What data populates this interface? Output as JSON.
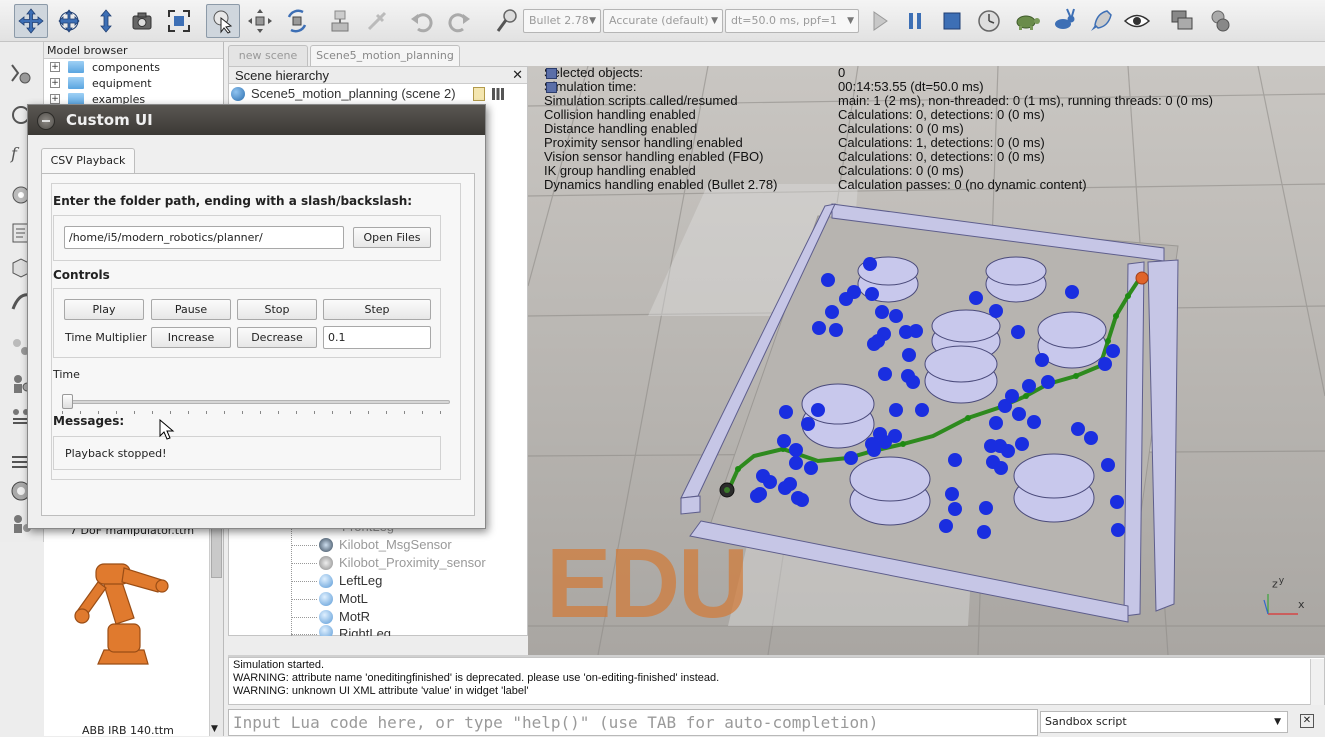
{
  "toolbar": {
    "engine": "Bullet 2.78",
    "accuracy": "Accurate (default)",
    "timestep": "dt=50.0 ms, ppf=1"
  },
  "model_browser": {
    "title": "Model browser",
    "folders": [
      "components",
      "equipment",
      "examples"
    ],
    "thumbnails": [
      {
        "label": "7 DoF manipulator.ttm"
      },
      {
        "label": "ABB IRB 140.ttm"
      }
    ]
  },
  "scene_tabs": [
    "new scene",
    "Scene5_motion_planning"
  ],
  "scene_hierarchy": {
    "title": "Scene hierarchy",
    "root": "Scene5_motion_planning (scene 2)",
    "items": [
      "Kilobot_MsgSensor",
      "Kilobot_Proximity_sensor",
      "LeftLeg",
      "MotL",
      "MotR",
      "RightLeg"
    ],
    "partial_item": "FrontLeg"
  },
  "info": {
    "rows": [
      {
        "label": "Selected objects:",
        "value": "0"
      },
      {
        "label": "Simulation time:",
        "value": "00:14:53.55 (dt=50.0 ms)"
      },
      {
        "label": "Simulation scripts called/resumed",
        "value": "main: 1 (2 ms), non-threaded: 0 (1 ms), running threads: 0 (0 ms)"
      },
      {
        "label": "Collision handling enabled",
        "value": "Calculations: 0, detections: 0 (0 ms)"
      },
      {
        "label": "Distance handling enabled",
        "value": "Calculations: 0 (0 ms)"
      },
      {
        "label": "Proximity sensor handling enabled",
        "value": "Calculations: 1, detections: 0 (0 ms)"
      },
      {
        "label": "Vision sensor handling enabled (FBO)",
        "value": "Calculations: 0, detections: 0 (0 ms)"
      },
      {
        "label": "IK group handling enabled",
        "value": "Calculations: 0 (0 ms)"
      },
      {
        "label": "Dynamics handling enabled (Bullet 2.78)",
        "value": "Calculation passes: 0 (no dynamic content)"
      }
    ]
  },
  "watermark": "EDU",
  "console": {
    "lines": [
      "Simulation started.",
      "WARNING: attribute name 'oneditingfinished' is deprecated. please use 'on-editing-finished' instead.",
      "WARNING: unknown UI XML attribute 'value' in widget 'label'"
    ],
    "input_placeholder": "Input Lua code here, or type \"help()\" (use TAB for auto-completion)",
    "script_selector": "Sandbox script"
  },
  "custom_ui": {
    "title": "Custom UI",
    "tab": "CSV Playback",
    "folder_label": "Enter the folder path, ending with a slash/backslash:",
    "folder_path": "/home/i5/modern_robotics/planner/",
    "open_files": "Open Files",
    "controls_label": "Controls",
    "play": "Play",
    "pause": "Pause",
    "stop": "Stop",
    "step": "Step",
    "time_multiplier_label": "Time Multiplier",
    "increase": "Increase",
    "decrease": "Decrease",
    "multiplier_value": "0.1",
    "time_label": "Time",
    "time_slider_fraction": 0,
    "messages_label": "Messages:",
    "message": "Playback stopped!"
  }
}
